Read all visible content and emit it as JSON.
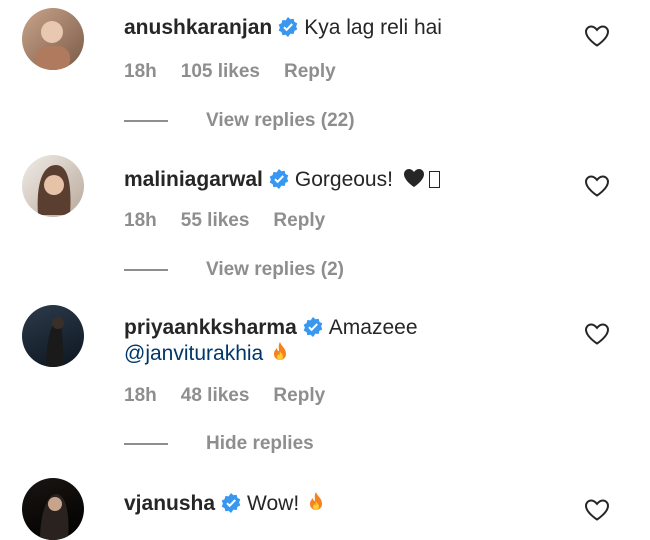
{
  "comments": [
    {
      "username": "anushkaranjan",
      "text": "Kya lag reli hai",
      "time": "18h",
      "likes": "105 likes",
      "reply": "Reply",
      "thread": "View replies (22)"
    },
    {
      "username": "maliniagarwal",
      "text": "Gorgeous!",
      "time": "18h",
      "likes": "55 likes",
      "reply": "Reply",
      "thread": "View replies (2)"
    },
    {
      "username": "priyaankksharma",
      "text": "Amazeee",
      "mention": "@janviturakhia",
      "time": "18h",
      "likes": "48 likes",
      "reply": "Reply",
      "thread": "Hide replies"
    },
    {
      "username": "vjanusha",
      "text": "Wow!"
    }
  ],
  "colors": {
    "verified": "#3897f0",
    "secondary_text": "#8e8e8e",
    "mention": "#00376b"
  }
}
